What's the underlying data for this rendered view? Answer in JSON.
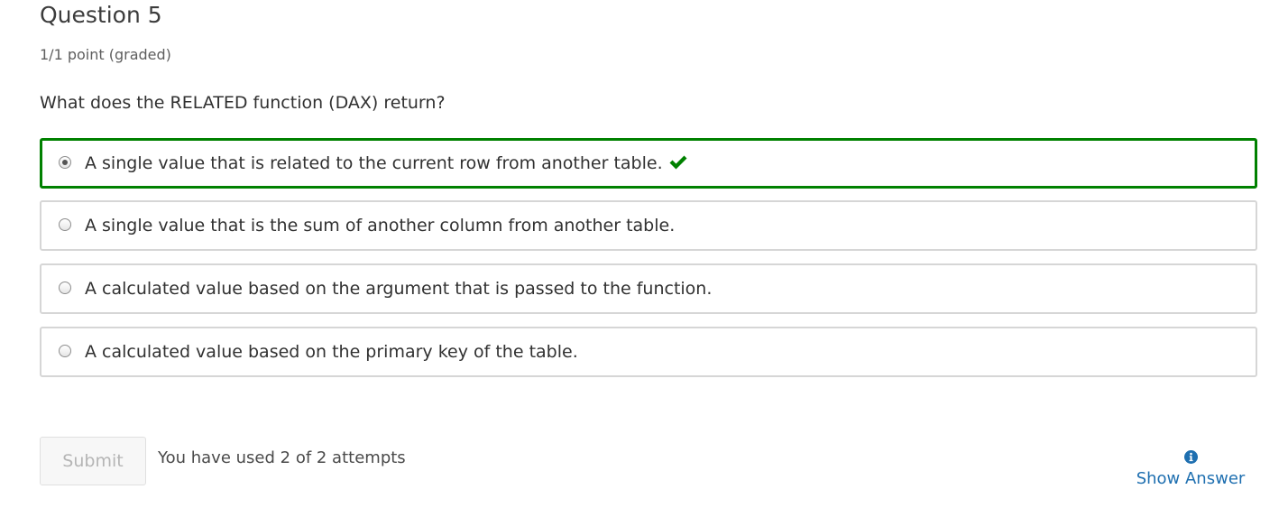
{
  "question": {
    "title": "Question 5",
    "points": "1/1 point (graded)",
    "prompt": "What does the RELATED function (DAX) return?"
  },
  "choices": [
    {
      "label": "A single value that is related to the current row from another table.",
      "selected": true,
      "correct": true
    },
    {
      "label": "A single value that is the sum of another column from another table.",
      "selected": false,
      "correct": false
    },
    {
      "label": "A calculated value based on the argument that is passed to the function.",
      "selected": false,
      "correct": false
    },
    {
      "label": "A calculated value based on the primary key of the table.",
      "selected": false,
      "correct": false
    }
  ],
  "actions": {
    "submit_label": "Submit",
    "submit_disabled": true,
    "attempts_text": "You have used 2 of 2 attempts",
    "show_answer_label": "Show Answer"
  },
  "icons": {
    "correct": "checkmark-icon",
    "show_answer": "info-icon"
  },
  "colors": {
    "correct_border": "#008100",
    "checkmark": "#008100",
    "link": "#1e6fb0",
    "default_border": "#d6d6d6"
  }
}
